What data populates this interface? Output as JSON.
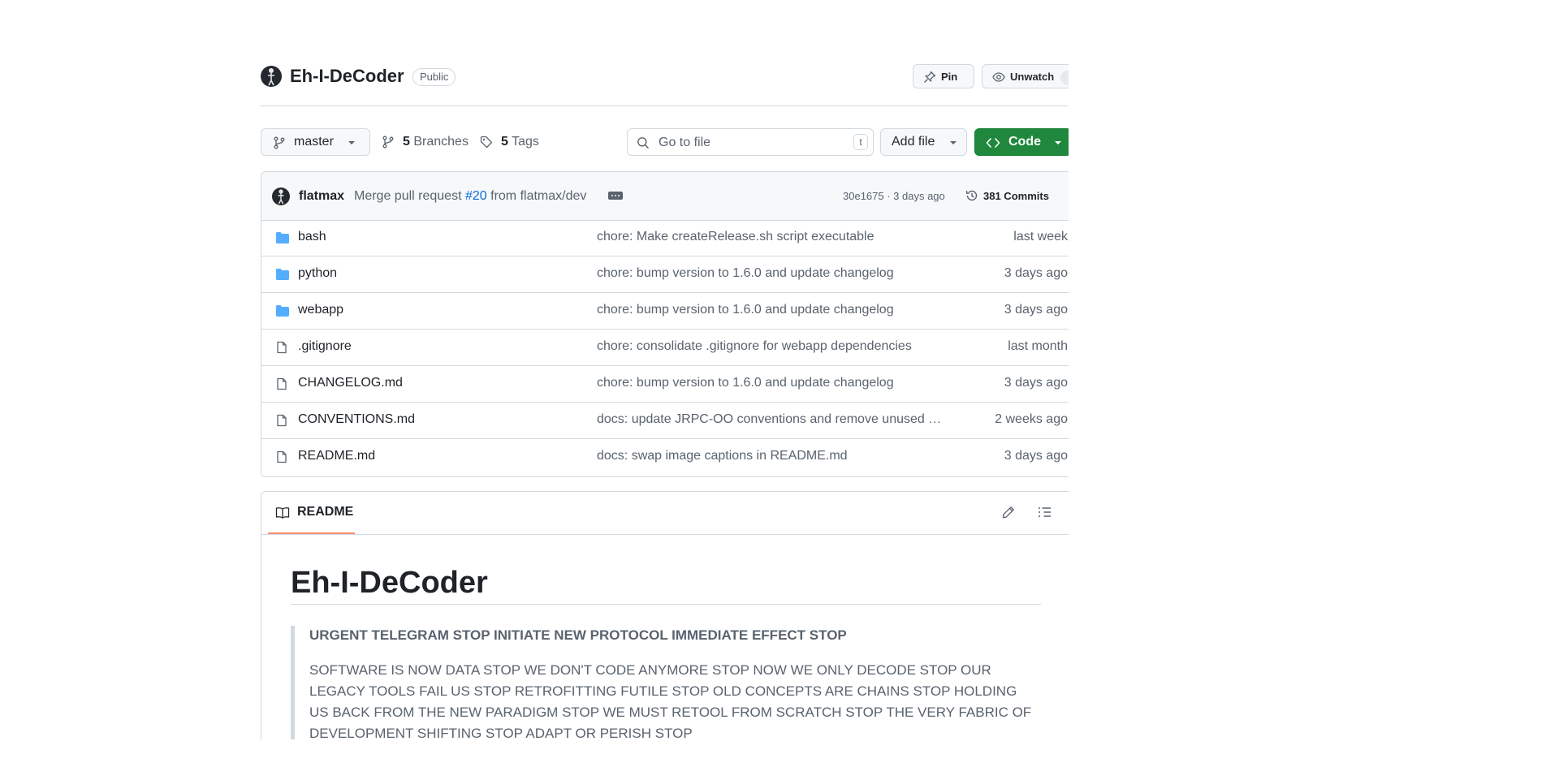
{
  "repo": {
    "name": "Eh-I-DeCoder",
    "visibility": "Public",
    "pin_label": "Pin",
    "unwatch_label": "Unwatch"
  },
  "toolbar": {
    "branch": "master",
    "branches_count": "5",
    "branches_label": "Branches",
    "tags_count": "5",
    "tags_label": "Tags",
    "search_placeholder": "Go to file",
    "search_shortcut": "t",
    "add_file_label": "Add file",
    "code_label": "Code"
  },
  "latest_commit": {
    "author": "flatmax",
    "message_prefix": "Merge pull request",
    "pr_ref": "#20",
    "message_suffix": "from flatmax/dev",
    "sha_time": "30e1675 · 3 days ago",
    "commits_label": "381 Commits"
  },
  "files": [
    {
      "name": "bash",
      "type": "folder",
      "message": "chore: Make createRelease.sh script executable",
      "date": "last week"
    },
    {
      "name": "python",
      "type": "folder",
      "message": "chore: bump version to 1.6.0 and update changelog",
      "date": "3 days ago"
    },
    {
      "name": "webapp",
      "type": "folder",
      "message": "chore: bump version to 1.6.0 and update changelog",
      "date": "3 days ago"
    },
    {
      "name": ".gitignore",
      "type": "file",
      "message": "chore: consolidate .gitignore for webapp dependencies",
      "date": "last month"
    },
    {
      "name": "CHANGELOG.md",
      "type": "file",
      "message": "chore: bump version to 1.6.0 and update changelog",
      "date": "3 days ago"
    },
    {
      "name": "CONVENTIONS.md",
      "type": "file",
      "message": "docs: update JRPC-OO conventions and remove unused s…",
      "date": "2 weeks ago"
    },
    {
      "name": "README.md",
      "type": "file",
      "message": "docs: swap image captions in README.md",
      "date": "3 days ago"
    }
  ],
  "readme": {
    "tab_label": "README",
    "heading": "Eh-I-DeCoder",
    "quote_strong": "URGENT TELEGRAM STOP INITIATE NEW PROTOCOL IMMEDIATE EFFECT STOP",
    "quote_body": "SOFTWARE IS NOW DATA STOP WE DON'T CODE ANYMORE STOP NOW WE ONLY DECODE STOP OUR LEGACY TOOLS FAIL US STOP RETROFITTING FUTILE STOP OLD CONCEPTS ARE CHAINS STOP HOLDING US BACK FROM THE NEW PARADIGM STOP WE MUST RETOOL FROM SCRATCH STOP THE VERY FABRIC OF DEVELOPMENT SHIFTING STOP ADAPT OR PERISH STOP"
  },
  "icons": {
    "folder_color": "#54aeff",
    "file_color": "#59636e"
  },
  "colors": {
    "code_button": "#1f883d",
    "link": "#0969da",
    "tab_underline": "#fd8c73"
  }
}
